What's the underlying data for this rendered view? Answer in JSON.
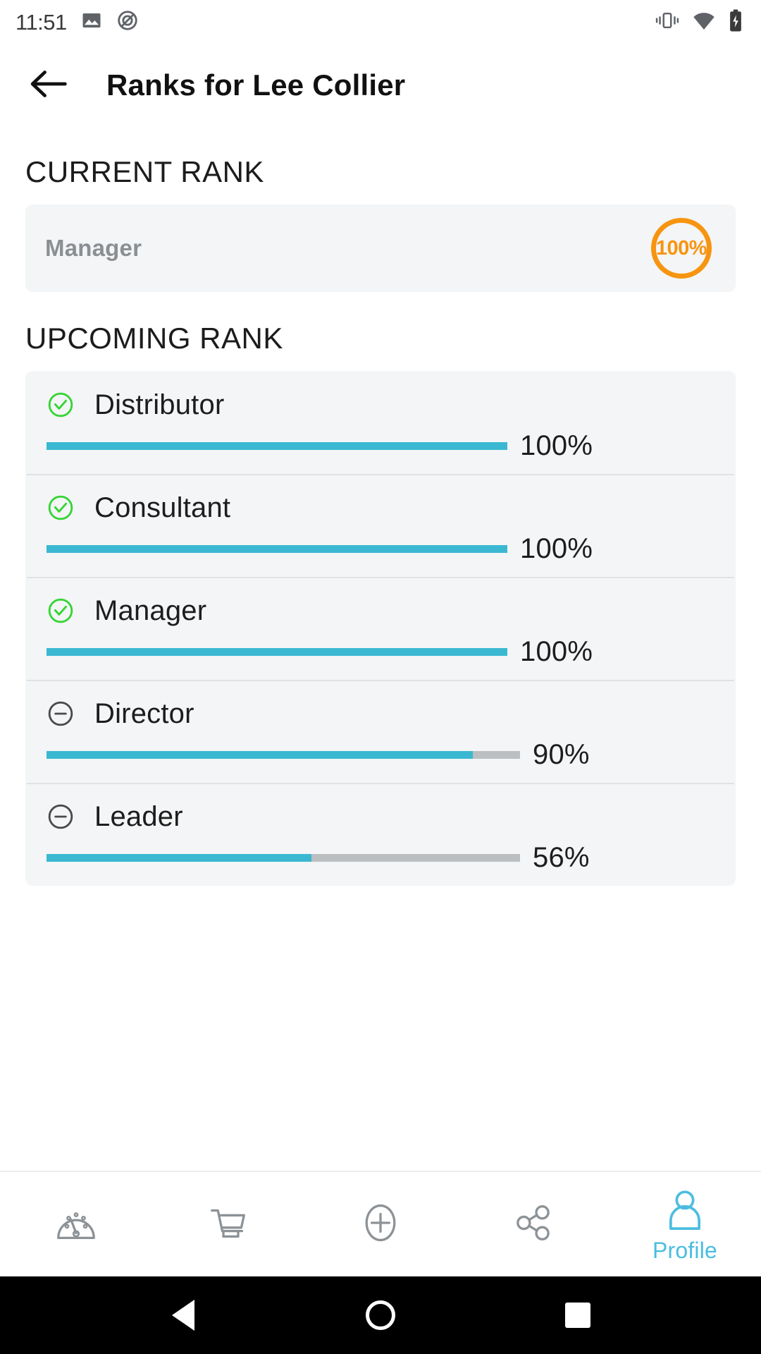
{
  "status_bar": {
    "time": "11:51",
    "left_icons": [
      "image-icon",
      "no-sync-icon"
    ],
    "right_icons": [
      "vibrate-icon",
      "wifi-icon",
      "battery-charging-icon"
    ]
  },
  "app_bar": {
    "back_icon": "arrow-left-icon",
    "title": "Ranks for Lee Collier"
  },
  "current_rank": {
    "section_title": "CURRENT RANK",
    "rank_name": "Manager",
    "percent_label": "100%",
    "accent_color": "#F79410"
  },
  "upcoming_rank": {
    "section_title": "UPCOMING RANK",
    "bar_fill_color": "#3ab8d2",
    "bar_track_color": "#bcbfc1",
    "complete_icon_color": "#35d435",
    "incomplete_icon_color": "#4a4a4a",
    "rows": [
      {
        "name": "Distributor",
        "percent": 100,
        "percent_label": "100%",
        "status": "complete",
        "status_icon": "check-circle-icon"
      },
      {
        "name": "Consultant",
        "percent": 100,
        "percent_label": "100%",
        "status": "complete",
        "status_icon": "check-circle-icon"
      },
      {
        "name": "Manager",
        "percent": 100,
        "percent_label": "100%",
        "status": "complete",
        "status_icon": "check-circle-icon"
      },
      {
        "name": "Director",
        "percent": 90,
        "percent_label": "90%",
        "status": "incomplete",
        "status_icon": "minus-circle-icon"
      },
      {
        "name": "Leader",
        "percent": 56,
        "percent_label": "56%",
        "status": "incomplete",
        "status_icon": "minus-circle-icon"
      }
    ]
  },
  "bottom_nav": {
    "active_color": "#4bbde0",
    "inactive_color": "#8c9296",
    "items": [
      {
        "icon": "dashboard-gauge-icon",
        "label": "",
        "active": false
      },
      {
        "icon": "shopping-cart-icon",
        "label": "",
        "active": false
      },
      {
        "icon": "add-circle-icon",
        "label": "",
        "active": false
      },
      {
        "icon": "share-network-icon",
        "label": "",
        "active": false
      },
      {
        "icon": "profile-person-icon",
        "label": "Profile",
        "active": true
      }
    ]
  },
  "system_nav": {
    "back": "back-triangle-icon",
    "home": "home-circle-icon",
    "recents": "recents-square-icon"
  }
}
